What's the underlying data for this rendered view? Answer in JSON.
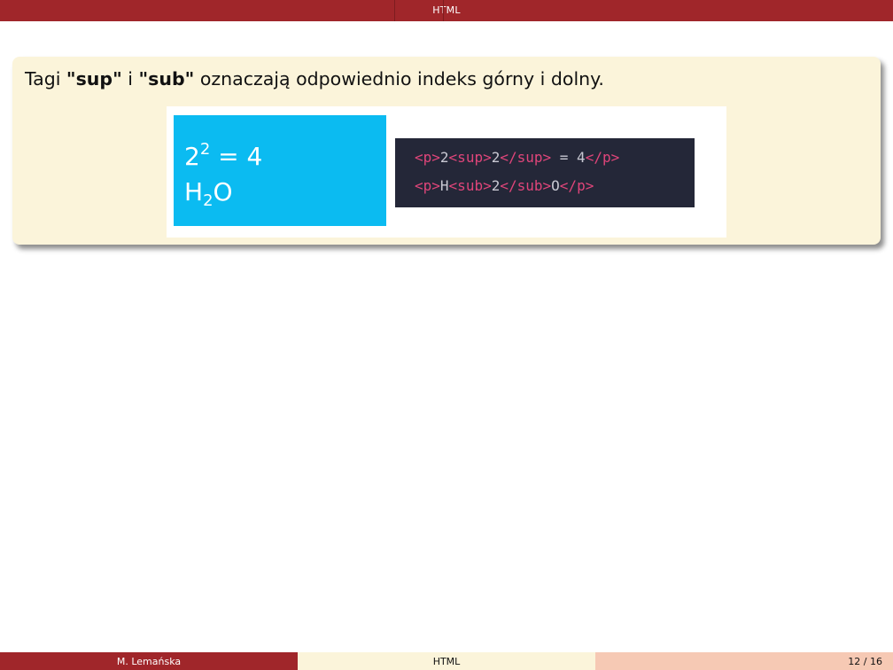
{
  "header": {
    "title": "HTML"
  },
  "block": {
    "text_before": "Tagi ",
    "sup_label": "\"sup\"",
    "text_mid": " i ",
    "sub_label": "\"sub\"",
    "text_after": " oznaczają odpowiednio indeks górny i dolny."
  },
  "figure": {
    "rendered": {
      "line1_base": "2",
      "line1_sup": "2",
      "line1_rest": " = 4",
      "line2_base": "H",
      "line2_sub": "2",
      "line2_rest": "O"
    },
    "code": {
      "line1": {
        "open_p": "<p>",
        "t1": "2",
        "open_sup": "<sup>",
        "t2": "2",
        "close_sup": "</sup>",
        "t3": " = 4",
        "close_p": "</p>"
      },
      "line2": {
        "open_p": "<p>",
        "t1": "H",
        "open_sub": "<sub>",
        "t2": "2",
        "close_sub": "</sub>",
        "t3": "O",
        "close_p": "</p>"
      }
    }
  },
  "footer": {
    "author": "M. Lemańska",
    "title": "HTML",
    "page": "12 / 16"
  },
  "colors": {
    "accent": "#a0262a",
    "block_bg": "#fbf4da",
    "figure_blue": "#0bbbf1",
    "code_bg": "#242738",
    "code_tag": "#e0457a",
    "footer_page_bg": "#f6c9b4"
  }
}
